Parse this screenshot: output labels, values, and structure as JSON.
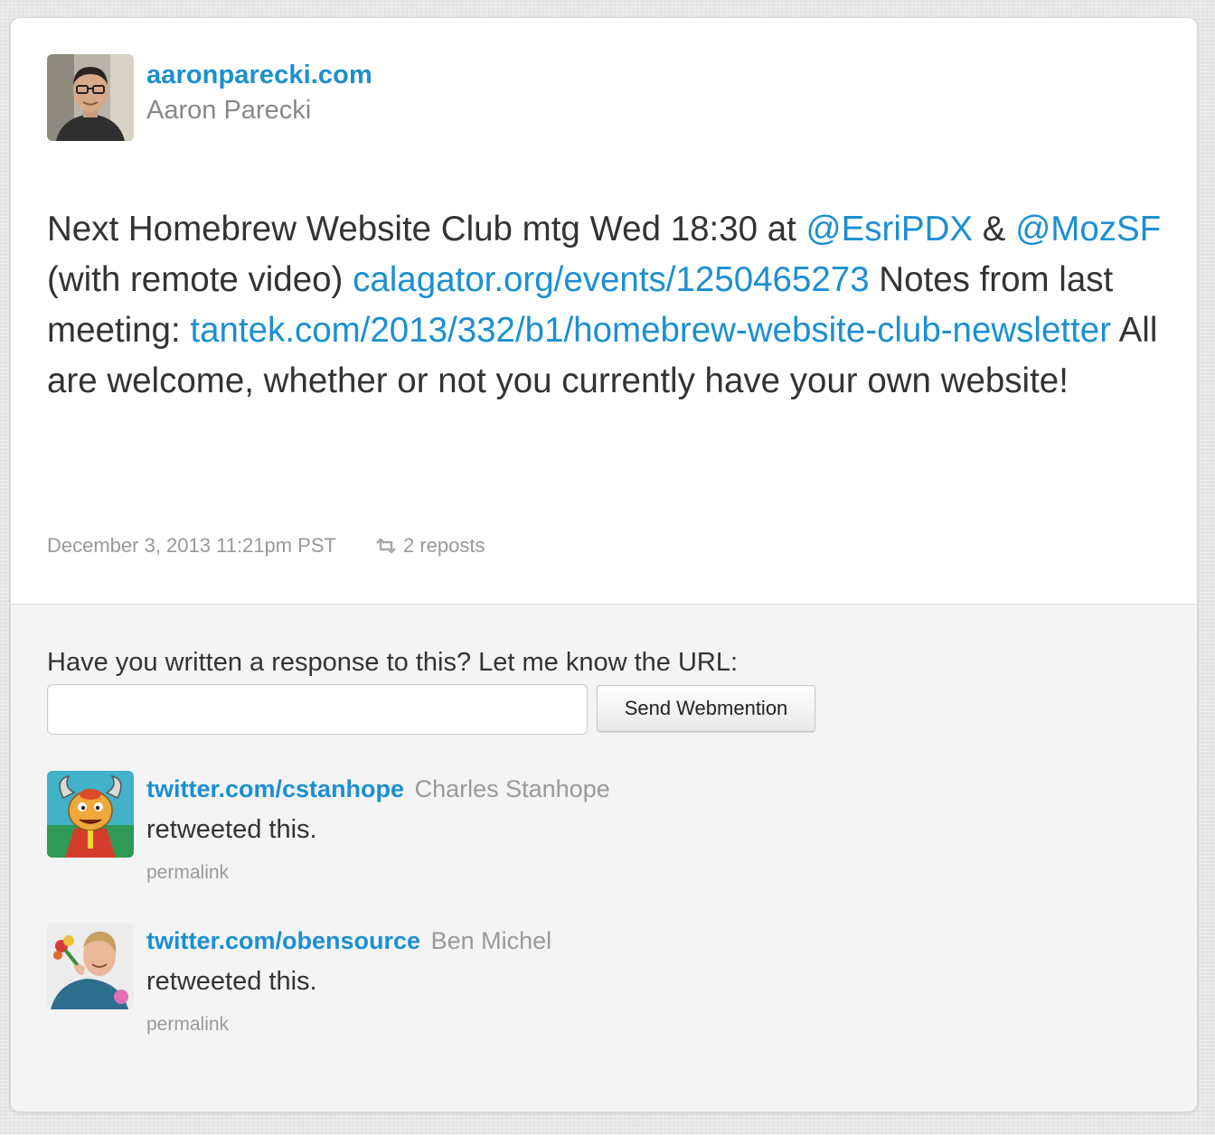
{
  "author": {
    "url": "aaronparecki.com",
    "name": "Aaron Parecki",
    "photo_icon": "author-photo"
  },
  "post": {
    "p1": "Next Homebrew Website Club mtg Wed 18:30 at ",
    "mention1": "@EsriPDX",
    "p2": " & ",
    "mention2": "@MozSF",
    "p3": " (with remote video) ",
    "link1": "calagator.org/events/1250465273",
    "p4": " Notes from last meeting: ",
    "link2": "tantek.com/2013/332/b1/homebrew-website-club-newsletter",
    "p5": " All are welcome, whether or not you currently have your own website!"
  },
  "meta": {
    "date": "December 3, 2013 11:21pm PST",
    "reposts": "2 reposts",
    "repost_icon": "repost-icon"
  },
  "webmention": {
    "prompt": "Have you written a response to this? Let me know the URL:",
    "input_value": "",
    "input_placeholder": "",
    "button_label": "Send Webmention"
  },
  "responses": [
    {
      "url": "twitter.com/cstanhope",
      "name": "Charles Stanhope",
      "text": "retweeted this.",
      "permalink": "permalink",
      "avatar_icon": "cartoon-monster-avatar"
    },
    {
      "url": "twitter.com/obensource",
      "name": "Ben Michel",
      "text": "retweeted this.",
      "permalink": "permalink",
      "avatar_icon": "person-with-flowers-avatar"
    }
  ],
  "colors": {
    "link": "#1c8fd1",
    "text": "#333333",
    "muted": "#999999",
    "panel": "#f4f4f4"
  }
}
